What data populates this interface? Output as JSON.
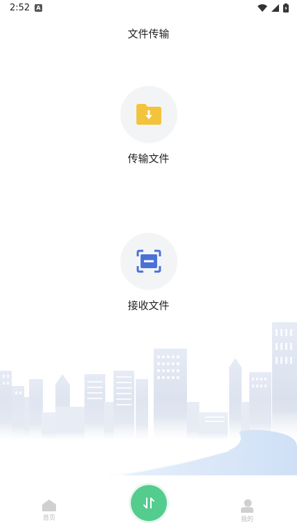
{
  "status": {
    "time": "2:52",
    "notif_letter": "A"
  },
  "header": {
    "title": "文件传输"
  },
  "actions": {
    "send": {
      "label": "传输文件",
      "icon": "folder-download-icon",
      "color": "#f3c43b"
    },
    "receive": {
      "label": "接收文件",
      "icon": "scan-icon",
      "color": "#4a72d6"
    }
  },
  "nav": {
    "home": {
      "label": "首页",
      "icon": "home-icon"
    },
    "center": {
      "icon": "transfer-arrows-icon",
      "color": "#54cc8e"
    },
    "mine": {
      "label": "我的",
      "icon": "user-icon"
    }
  }
}
